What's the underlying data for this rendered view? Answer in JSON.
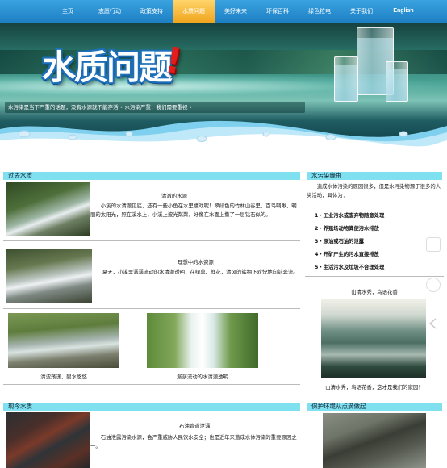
{
  "nav": {
    "items": [
      {
        "label": "主页"
      },
      {
        "label": "志愿行动"
      },
      {
        "label": "政策支持"
      },
      {
        "label": "水质问题",
        "active": true
      },
      {
        "label": "美好未来"
      },
      {
        "label": "环保百科"
      },
      {
        "label": "绿色粒电"
      },
      {
        "label": "关于我们"
      },
      {
        "label": "English"
      }
    ],
    "bg_color": "#2a90d4",
    "active_color": "#f4b431"
  },
  "banner": {
    "title": "水质问题",
    "exclaim": "!",
    "ticker": "水污染是当下严重的话题，没有水源就不能存活 • 水污染严重，我们需要重视 •"
  },
  "past": {
    "heading": "过去水质",
    "article1": {
      "title": "清澈的水源",
      "body": "小溪的水清澈见底，还有一些小鱼在水里嬉戏呢！翠绿色的竹林山谷里，百鸟啁啾，明丽的太阳光，照在溪水上，小溪上波光粼粼，好像在水面上撒了一层钻石似的。"
    },
    "article2": {
      "title": "理想中的水资源",
      "body": "夏天，小溪里潺潺流动的水清澈透明，在绿草、鲜花，清风的簇拥下欢快地向前奔流。"
    },
    "captions": [
      "清波荡漾，碧水悠悠",
      "潺潺流动的水清澈透明"
    ]
  },
  "present": {
    "heading": "现今水质",
    "article": {
      "title": "石油管道泄漏",
      "body": "石油泄露污染水源，会严重威胁人民饮水安全；也是近年来造成水体污染的重要原因之一。"
    }
  },
  "side": {
    "heading1": "水污染缘由",
    "intro": "造成水体污染的原因很多，但是水污染物源于很多的人类活动，具体为：",
    "items": [
      "1・工业污水或废弃物随意处理",
      "2・养殖场动物粪便污水排放",
      "3・原油或石油的泄露",
      "4・开矿产生的污水直接排放",
      "5・生活污水及垃圾不合理处理"
    ],
    "photo_title": "山清水秀，鸟语花香",
    "photo_caption": "山清水秀，鸟语花香，这才是我们的家园！",
    "heading2": "保护环境从点滴做起"
  },
  "colors": {
    "section_head": "#7fe0ef"
  }
}
